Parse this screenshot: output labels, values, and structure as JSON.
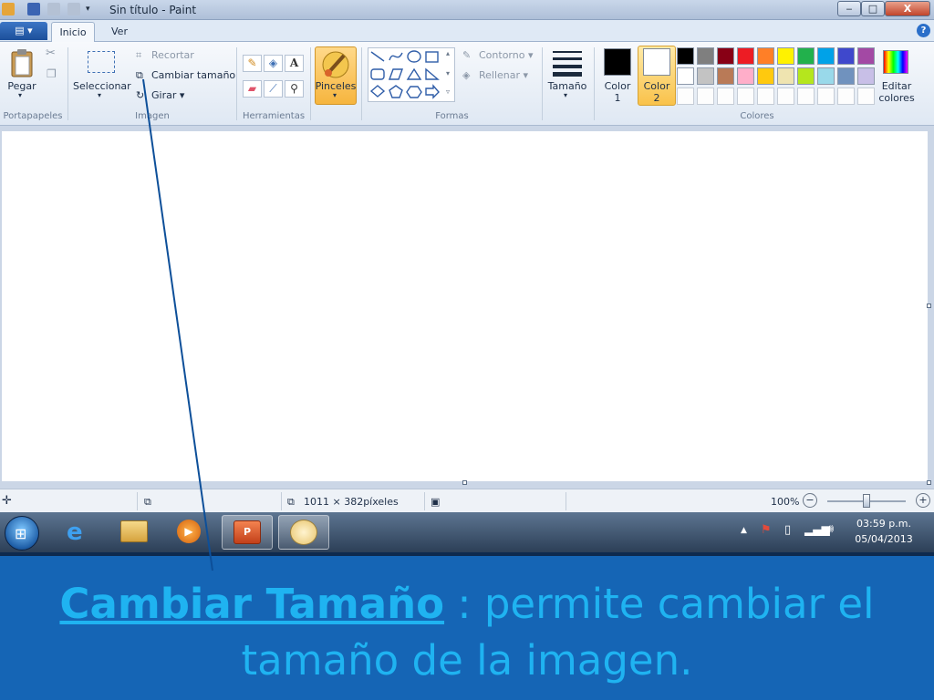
{
  "window": {
    "title": "Sin título - Paint",
    "controls": {
      "minimize": "‒",
      "maximize": "□",
      "close": "X"
    }
  },
  "tabs": {
    "file": "▤ ▾",
    "items": [
      {
        "label": "Inicio",
        "active": true
      },
      {
        "label": "Ver",
        "active": false
      }
    ],
    "help": "?"
  },
  "ribbon": {
    "clipboard": {
      "group_label": "Portapapeles",
      "paste": "Pegar"
    },
    "image": {
      "group_label": "Imagen",
      "select": "Seleccionar",
      "crop": "Recortar",
      "resize": "Cambiar tamaño",
      "rotate": "Girar ▾"
    },
    "tools": {
      "group_label": "Herramientas",
      "text_icon": "A"
    },
    "brushes": {
      "label": "Pinceles"
    },
    "shapes": {
      "group_label": "Formas",
      "outline": "Contorno ▾",
      "fill": "Rellenar ▾"
    },
    "size": {
      "label": "Tamaño"
    },
    "colors": {
      "group_label": "Colores",
      "color1_line1": "Color",
      "color1_line2": "1",
      "color2_line1": "Color",
      "color2_line2": "2",
      "edit_line1": "Editar",
      "edit_line2": "colores",
      "color1": "#000000",
      "color2": "#ffffff",
      "palette_row1": [
        "#000000",
        "#7f7f7f",
        "#880015",
        "#ed1c24",
        "#ff7f27",
        "#fff200",
        "#22b14c",
        "#00a2e8",
        "#3f48cc",
        "#a349a4"
      ],
      "palette_row2": [
        "#ffffff",
        "#c3c3c3",
        "#b97a57",
        "#ffaec9",
        "#ffc90e",
        "#efe4b0",
        "#b5e61d",
        "#99d9ea",
        "#7092be",
        "#c8bfe7"
      ],
      "palette_row3": [
        "",
        "",
        "",
        "",
        "",
        "",
        "",
        "",
        "",
        ""
      ]
    }
  },
  "statusbar": {
    "canvas_size": "1011 × 382píxeles",
    "zoom": "100%"
  },
  "taskbar": {
    "time": "03:59 p.m.",
    "date": "05/04/2013"
  },
  "slide": {
    "caption_title": "Cambiar Tamaño",
    "caption_sep": " : ",
    "caption_text": "permite cambiar el tamaño de la imagen."
  }
}
